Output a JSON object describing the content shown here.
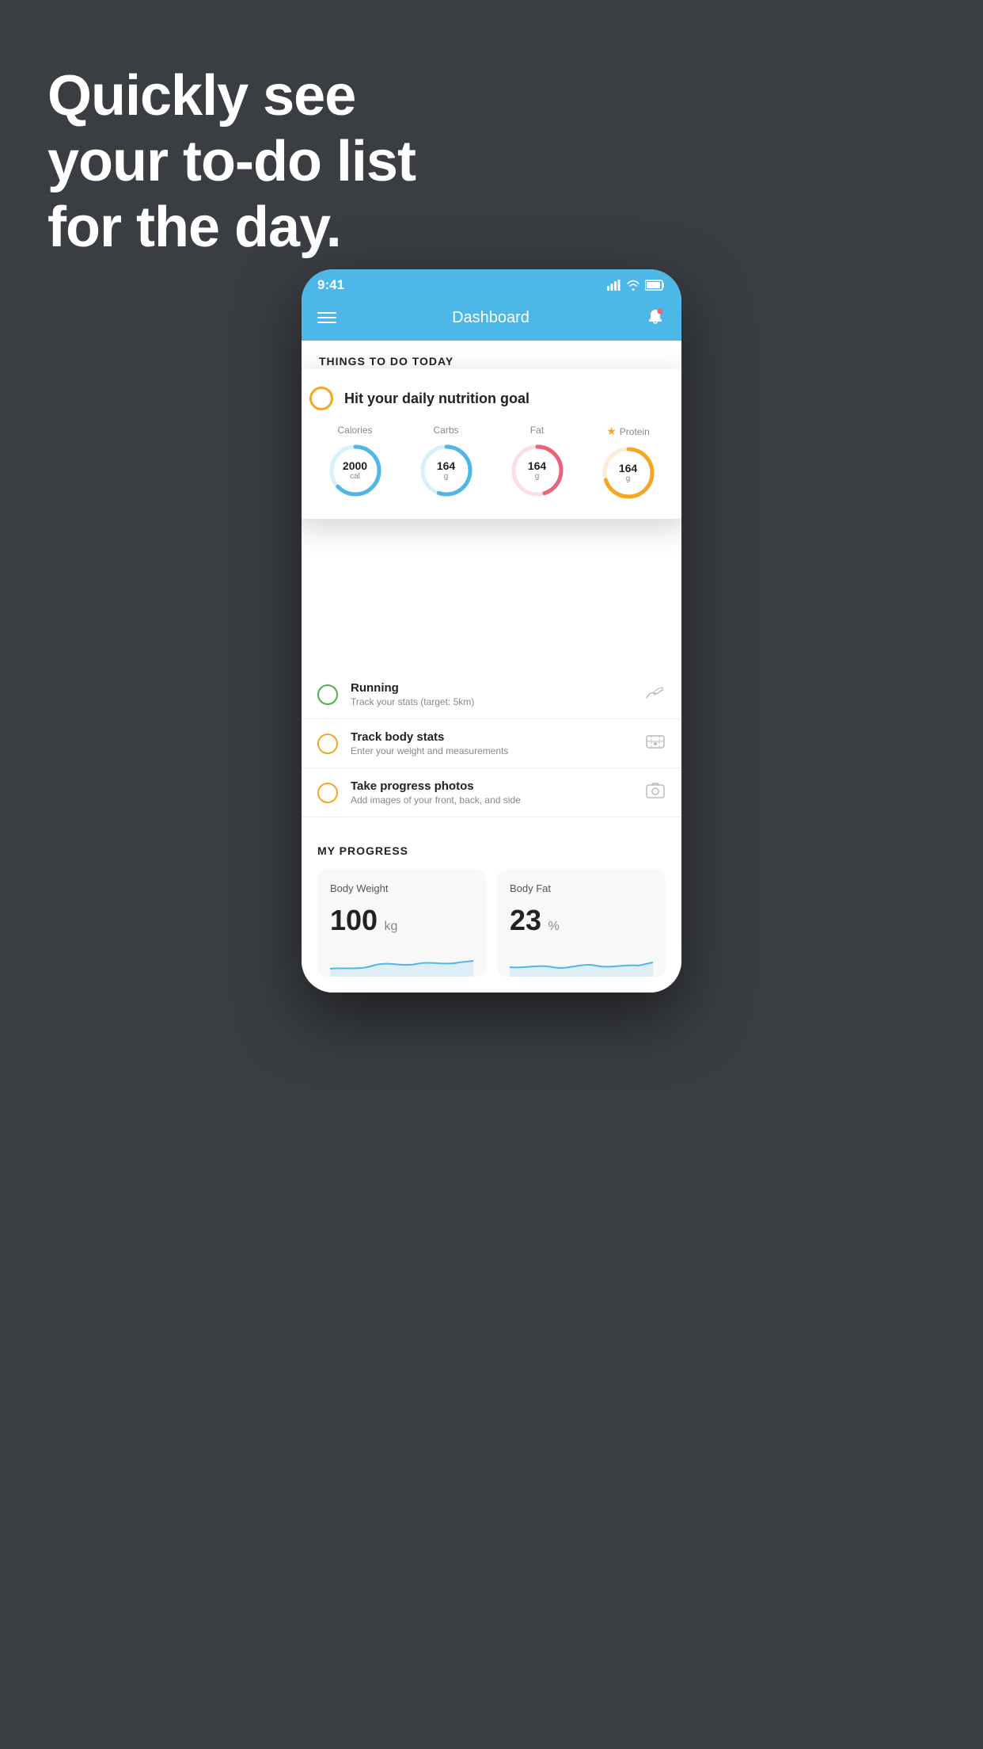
{
  "hero": {
    "line1": "Quickly see",
    "line2": "your to-do list",
    "line3": "for the day."
  },
  "statusBar": {
    "time": "9:41",
    "signal": "▌▌▌▌",
    "wifi": "wifi",
    "battery": "battery"
  },
  "navBar": {
    "title": "Dashboard"
  },
  "floatingCard": {
    "title": "Hit your daily nutrition goal",
    "nutrition": [
      {
        "label": "Calories",
        "value": "2000",
        "unit": "cal",
        "color": "#4db8e8",
        "bgColor": "#d8f0fa",
        "percent": 65,
        "star": false
      },
      {
        "label": "Carbs",
        "value": "164",
        "unit": "g",
        "color": "#4db8e8",
        "bgColor": "#d8f0fa",
        "percent": 55,
        "star": false
      },
      {
        "label": "Fat",
        "value": "164",
        "unit": "g",
        "color": "#e8647a",
        "bgColor": "#fae0e3",
        "percent": 45,
        "star": false
      },
      {
        "label": "Protein",
        "value": "164",
        "unit": "g",
        "color": "#f5a623",
        "bgColor": "#faecd8",
        "percent": 70,
        "star": true
      }
    ]
  },
  "todoItems": [
    {
      "name": "Running",
      "desc": "Track your stats (target: 5km)",
      "circleColor": "green",
      "icon": "👟"
    },
    {
      "name": "Track body stats",
      "desc": "Enter your weight and measurements",
      "circleColor": "yellow",
      "icon": "⚖"
    },
    {
      "name": "Take progress photos",
      "desc": "Add images of your front, back, and side",
      "circleColor": "yellow",
      "icon": "🖼"
    }
  ],
  "sectionHeader": "THINGS TO DO TODAY",
  "progressSection": {
    "title": "MY PROGRESS",
    "cards": [
      {
        "title": "Body Weight",
        "value": "100",
        "unit": "kg"
      },
      {
        "title": "Body Fat",
        "value": "23",
        "unit": "%"
      }
    ]
  }
}
